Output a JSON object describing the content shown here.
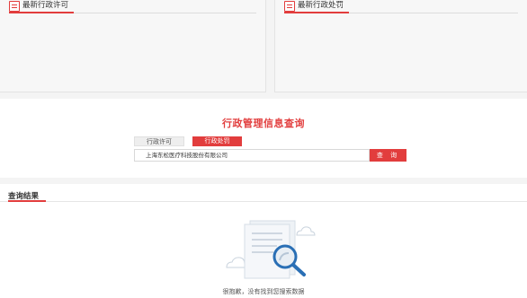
{
  "panels": {
    "left": {
      "title": "最新行政许可",
      "icon": "document-icon"
    },
    "right": {
      "title": "最新行政处罚",
      "icon": "document-icon"
    }
  },
  "search": {
    "title": "行政管理信息查询",
    "tabs": [
      {
        "label": "行政许可",
        "active": false
      },
      {
        "label": "行政处罚",
        "active": true
      }
    ],
    "input_value": "上海东松医疗科技股份有限公司",
    "button_label": "查 询"
  },
  "results": {
    "title": "查询结果",
    "empty_message": "很抱歉，没有找到您搜索数据",
    "empty_icon": "magnifier-document-icon"
  },
  "colors": {
    "accent": "#e23d3d",
    "panel_bg": "#f7f7f7",
    "band_bg": "#f4f4f4"
  }
}
